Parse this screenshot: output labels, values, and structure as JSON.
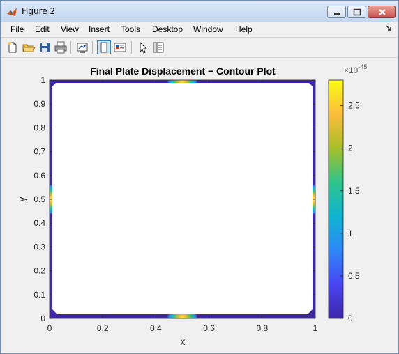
{
  "window": {
    "title": "Figure 2"
  },
  "menu": [
    "File",
    "Edit",
    "View",
    "Insert",
    "Tools",
    "Desktop",
    "Window",
    "Help"
  ],
  "toolbar_icons": [
    "new-figure-icon",
    "open-file-icon",
    "save-icon",
    "print-icon",
    "link-plot-icon",
    "hide-plot-tools-icon",
    "show-plot-tools-icon",
    "edit-plot-icon",
    "open-property-inspector-icon"
  ],
  "chart_data": {
    "type": "heatmap",
    "title": "Final Plate Displacement − Contour Plot",
    "xlabel": "x",
    "ylabel": "y",
    "xlim": [
      0,
      1
    ],
    "ylim": [
      0,
      1
    ],
    "xticks": [
      "0",
      "0.2",
      "0.4",
      "0.6",
      "0.8",
      "1"
    ],
    "yticks": [
      "0",
      "0.1",
      "0.2",
      "0.3",
      "0.4",
      "0.5",
      "0.6",
      "0.7",
      "0.8",
      "0.9",
      "1"
    ],
    "colorbar": {
      "exponent_label": "×10",
      "exponent": "-45",
      "ticks": [
        "0",
        "0.5",
        "1",
        "1.5",
        "2",
        "2.5"
      ],
      "range": [
        0,
        2.8
      ],
      "colormap": [
        "#3e26a8",
        "#4745f3",
        "#2e87f7",
        "#0fb4d1",
        "#2ec48b",
        "#a7bf28",
        "#fcbd3c",
        "#f9fb15"
      ]
    },
    "hotspots": [
      {
        "x": 0.5,
        "y": 1.0,
        "peak": 2.8
      },
      {
        "x": 0.5,
        "y": 0.0,
        "peak": 2.8
      },
      {
        "x": 0.0,
        "y": 0.5,
        "peak": 2.8
      },
      {
        "x": 1.0,
        "y": 0.5,
        "peak": 2.8
      }
    ]
  }
}
